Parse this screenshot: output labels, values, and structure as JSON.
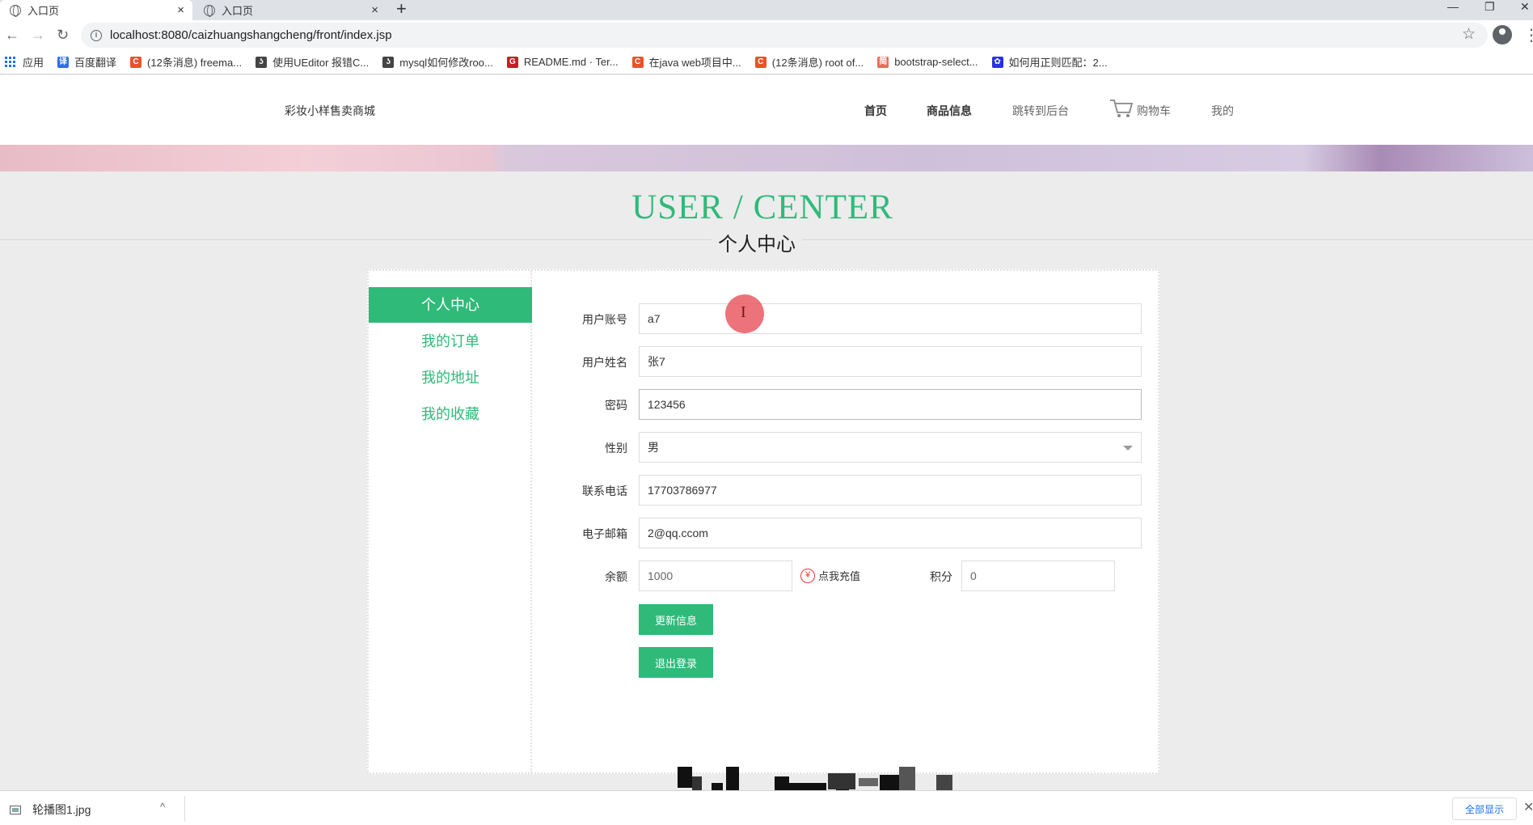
{
  "browser": {
    "tabs": [
      {
        "title": "入口页",
        "close": "×"
      },
      {
        "title": "入口页",
        "close": "×"
      }
    ],
    "new_tab": "+",
    "window_controls": {
      "minimize": "—",
      "restore": "❐",
      "close": "✕"
    },
    "nav": {
      "back": "←",
      "forward": "→",
      "reload": "↻"
    },
    "url": "localhost:8080/caizhuangshangcheng/front/index.jsp",
    "star": "☆",
    "menu": "⋮",
    "bookmarks": [
      {
        "label": "应用",
        "icon": "apps-grid-icon",
        "color": "#1a73e8",
        "glyph": ""
      },
      {
        "label": "百度翻译",
        "icon": "baidu-translate-icon",
        "color": "#2f6fe4",
        "glyph": "译"
      },
      {
        "label": "(12条消息) freema...",
        "icon": "csdn-icon",
        "color": "#e8532a",
        "glyph": "C"
      },
      {
        "label": "使用UEditor 报错C...",
        "icon": "chinese-bookmark-icon",
        "color": "#444444",
        "glyph": "ʖ"
      },
      {
        "label": "mysql如何修改roo...",
        "icon": "chinese-bookmark-icon",
        "color": "#444444",
        "glyph": "ʖ"
      },
      {
        "label": "README.md · Ter...",
        "icon": "gitee-icon",
        "color": "#c71d23",
        "glyph": "G"
      },
      {
        "label": "在java web项目中...",
        "icon": "csdn-icon",
        "color": "#e8532a",
        "glyph": "C"
      },
      {
        "label": "(12条消息) root of...",
        "icon": "csdn-icon",
        "color": "#e8532a",
        "glyph": "C"
      },
      {
        "label": "bootstrap-select...",
        "icon": "jianshu-icon",
        "color": "#e96d5a",
        "glyph": "简"
      },
      {
        "label": "如何用正则匹配：2...",
        "icon": "baidu-paw-icon",
        "color": "#2932e1",
        "glyph": "✿"
      }
    ]
  },
  "site": {
    "logo": "彩妆小样售卖商城",
    "nav": [
      {
        "label": "首页"
      },
      {
        "label": "商品信息"
      },
      {
        "label": "跳转到后台"
      },
      {
        "label": "购物车"
      },
      {
        "label": "我的"
      }
    ],
    "accent": "#2fba7a"
  },
  "heading": {
    "en": "USER / CENTER",
    "cn": "个人中心"
  },
  "sidebar": {
    "items": [
      {
        "label": "个人中心",
        "active": true
      },
      {
        "label": "我的订单",
        "active": false
      },
      {
        "label": "我的地址",
        "active": false
      },
      {
        "label": "我的收藏",
        "active": false
      }
    ]
  },
  "form": {
    "account": {
      "label": "用户账号",
      "value": "a7"
    },
    "name": {
      "label": "用户姓名",
      "value": "张7"
    },
    "password": {
      "label": "密码",
      "value": "123456"
    },
    "gender": {
      "label": "性别",
      "value": "男"
    },
    "phone": {
      "label": "联系电话",
      "value": "17703786977"
    },
    "email": {
      "label": "电子邮箱",
      "value": "2@qq.ccom"
    },
    "balance": {
      "label": "余额",
      "value": "1000"
    },
    "recharge": {
      "label": "点我充值",
      "glyph": "¥"
    },
    "points": {
      "label": "积分",
      "value": "0"
    },
    "update_button": "更新信息",
    "logout_button": "退出登录"
  },
  "download_bar": {
    "file_name": "轮播图1.jpg",
    "show_all": "全部显示",
    "caret": "^",
    "close": "✕"
  }
}
